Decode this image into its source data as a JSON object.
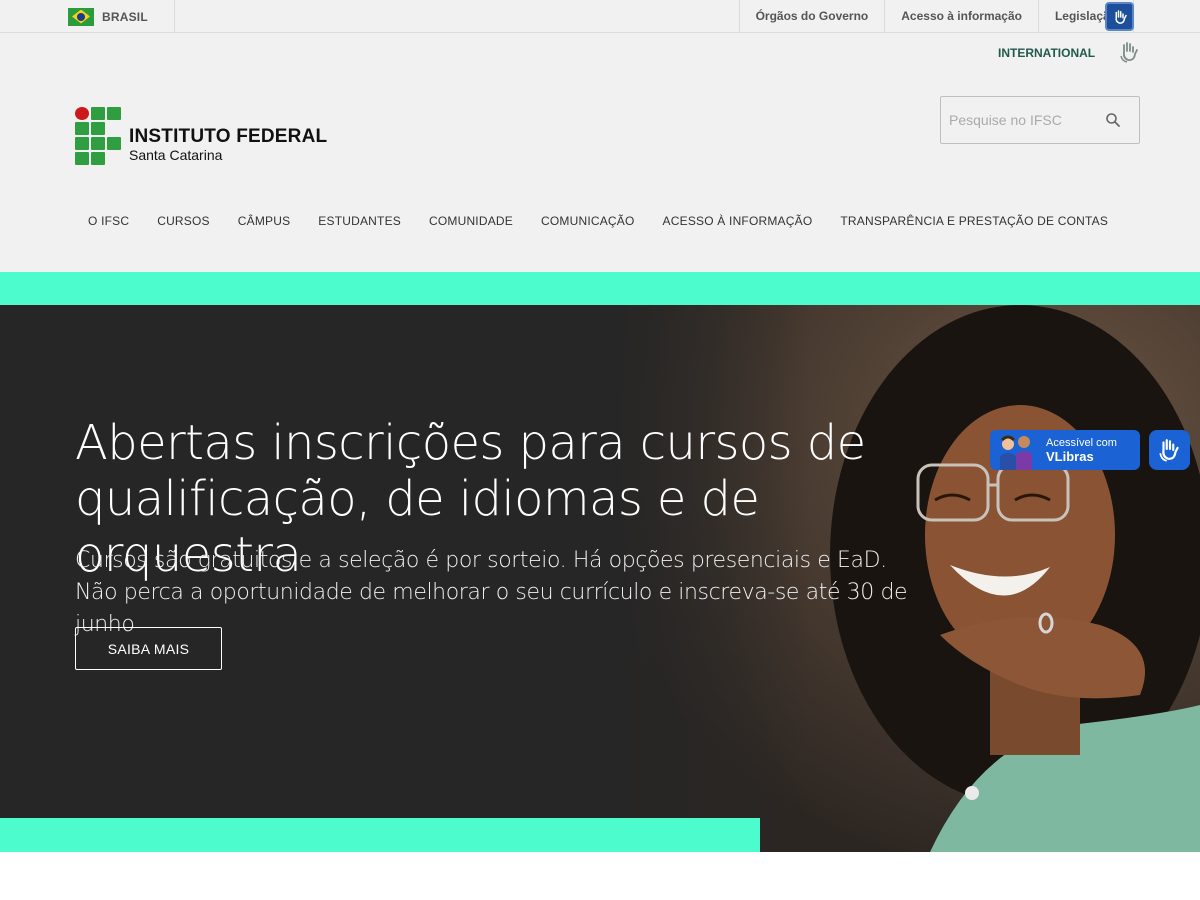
{
  "govbar": {
    "country_label": "BRASIL",
    "links": [
      "Órgãos do Governo",
      "Acesso à informação",
      "Legislação"
    ]
  },
  "header": {
    "international_label": "INTERNATIONAL",
    "logo": {
      "title": "INSTITUTO FEDERAL",
      "subtitle": "Santa Catarina"
    },
    "search": {
      "placeholder": "Pesquise no IFSC"
    },
    "nav": [
      "O IFSC",
      "CURSOS",
      "CÂMPUS",
      "ESTUDANTES",
      "COMUNIDADE",
      "COMUNICAÇÃO",
      "ACESSO À INFORMAÇÃO",
      "TRANSPARÊNCIA E PRESTAÇÃO DE CONTAS"
    ]
  },
  "hero": {
    "title": "Abertas inscrições para cursos de qualificação, de idiomas e de orquestra",
    "subtitle": "Cursos são gratuitos e a seleção é por sorteio. Há opções presenciais e EaD. Não perca a oportunidade de melhorar o seu currículo e inscreva-se até 30 de junho",
    "button_label": "SAIBA MAIS"
  },
  "vlibras": {
    "line1": "Acessível com",
    "line2": "VLibras"
  },
  "colors": {
    "accent_teal": "#4dfccd",
    "hero_bg": "#262626",
    "vlibras_blue": "#1b62d4",
    "logo_green": "#2f9e41",
    "logo_red": "#cd191e"
  },
  "icons": [
    "brazil-flag-icon",
    "sign-language-hand-icon",
    "search-icon"
  ]
}
